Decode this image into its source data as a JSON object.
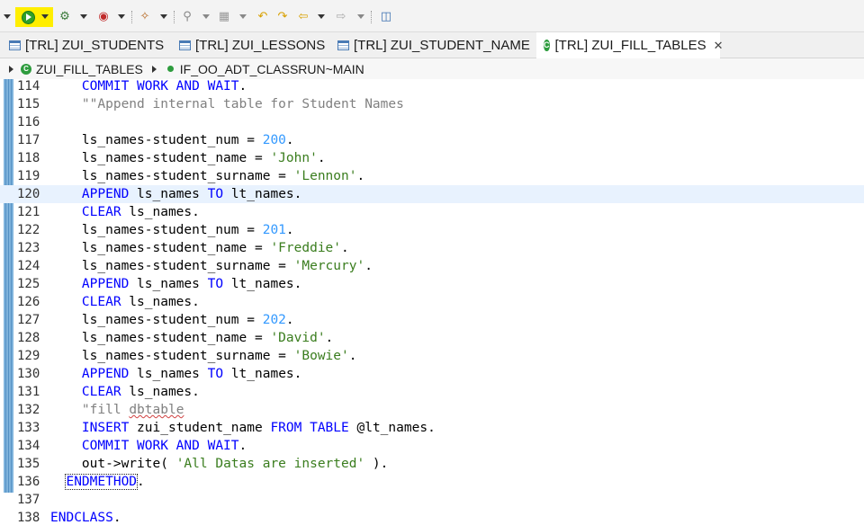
{
  "toolbar": {
    "items": [
      "run-icon",
      "debug-as-icon",
      "external-tools-icon",
      "new-wizard-icon",
      "search-icon",
      "annotation-icon",
      "prev-annotation-icon",
      "next-annotation-icon",
      "back-icon",
      "forward-icon",
      "open-console-icon"
    ]
  },
  "tabs": [
    {
      "label": "[TRL] ZUI_STUDENTS",
      "active": false
    },
    {
      "label": "[TRL] ZUI_LESSONS",
      "active": false
    },
    {
      "label": "[TRL] ZUI_STUDENT_NAME",
      "active": false
    },
    {
      "label": "[TRL] ZUI_FILL_TABLES",
      "active": true
    }
  ],
  "breadcrumb": {
    "class_name": "ZUI_FILL_TABLES",
    "method": "IF_OO_ADT_CLASSRUN~MAIN"
  },
  "editor": {
    "current_line": 120,
    "lines": [
      {
        "n": "114",
        "indent": "    ",
        "tokens": [
          [
            "kw",
            "COMMIT WORK AND WAIT"
          ],
          [
            "plain",
            "."
          ]
        ]
      },
      {
        "n": "115",
        "indent": "    ",
        "tokens": [
          [
            "com",
            "\"\"Append internal table for Student Names"
          ]
        ]
      },
      {
        "n": "116",
        "indent": "",
        "tokens": []
      },
      {
        "n": "117",
        "indent": "    ",
        "tokens": [
          [
            "plain",
            "ls_names-student_num = "
          ],
          [
            "num",
            "200"
          ],
          [
            "plain",
            "."
          ]
        ]
      },
      {
        "n": "118",
        "indent": "    ",
        "tokens": [
          [
            "plain",
            "ls_names-student_name = "
          ],
          [
            "str",
            "'John'"
          ],
          [
            "plain",
            "."
          ]
        ]
      },
      {
        "n": "119",
        "indent": "    ",
        "tokens": [
          [
            "plain",
            "ls_names-student_surname = "
          ],
          [
            "str",
            "'Lennon'"
          ],
          [
            "plain",
            "."
          ]
        ]
      },
      {
        "n": "120",
        "indent": "    ",
        "tokens": [
          [
            "kw",
            "APPEND"
          ],
          [
            "plain",
            " ls_names "
          ],
          [
            "kw",
            "TO"
          ],
          [
            "plain",
            " lt_names."
          ]
        ]
      },
      {
        "n": "121",
        "indent": "    ",
        "tokens": [
          [
            "kw",
            "CLEAR"
          ],
          [
            "plain",
            " ls_names."
          ]
        ]
      },
      {
        "n": "122",
        "indent": "    ",
        "tokens": [
          [
            "plain",
            "ls_names-student_num = "
          ],
          [
            "num",
            "201"
          ],
          [
            "plain",
            "."
          ]
        ]
      },
      {
        "n": "123",
        "indent": "    ",
        "tokens": [
          [
            "plain",
            "ls_names-student_name = "
          ],
          [
            "str",
            "'Freddie'"
          ],
          [
            "plain",
            "."
          ]
        ]
      },
      {
        "n": "124",
        "indent": "    ",
        "tokens": [
          [
            "plain",
            "ls_names-student_surname = "
          ],
          [
            "str",
            "'Mercury'"
          ],
          [
            "plain",
            "."
          ]
        ]
      },
      {
        "n": "125",
        "indent": "    ",
        "tokens": [
          [
            "kw",
            "APPEND"
          ],
          [
            "plain",
            " ls_names "
          ],
          [
            "kw",
            "TO"
          ],
          [
            "plain",
            " lt_names."
          ]
        ]
      },
      {
        "n": "126",
        "indent": "    ",
        "tokens": [
          [
            "kw",
            "CLEAR"
          ],
          [
            "plain",
            " ls_names."
          ]
        ]
      },
      {
        "n": "127",
        "indent": "    ",
        "tokens": [
          [
            "plain",
            "ls_names-student_num = "
          ],
          [
            "num",
            "202"
          ],
          [
            "plain",
            "."
          ]
        ]
      },
      {
        "n": "128",
        "indent": "    ",
        "tokens": [
          [
            "plain",
            "ls_names-student_name = "
          ],
          [
            "str",
            "'David'"
          ],
          [
            "plain",
            "."
          ]
        ]
      },
      {
        "n": "129",
        "indent": "    ",
        "tokens": [
          [
            "plain",
            "ls_names-student_surname = "
          ],
          [
            "str",
            "'Bowie'"
          ],
          [
            "plain",
            "."
          ]
        ]
      },
      {
        "n": "130",
        "indent": "    ",
        "tokens": [
          [
            "kw",
            "APPEND"
          ],
          [
            "plain",
            " ls_names "
          ],
          [
            "kw",
            "TO"
          ],
          [
            "plain",
            " lt_names."
          ]
        ]
      },
      {
        "n": "131",
        "indent": "    ",
        "tokens": [
          [
            "kw",
            "CLEAR"
          ],
          [
            "plain",
            " ls_names."
          ]
        ]
      },
      {
        "n": "132",
        "indent": "    ",
        "tokens": [
          [
            "com",
            "\"fill "
          ],
          [
            "com squig",
            "dbtable"
          ]
        ]
      },
      {
        "n": "133",
        "indent": "    ",
        "tokens": [
          [
            "kw",
            "INSERT"
          ],
          [
            "plain",
            " zui_student_name "
          ],
          [
            "kw",
            "FROM TABLE"
          ],
          [
            "plain",
            " @lt_names."
          ]
        ]
      },
      {
        "n": "134",
        "indent": "    ",
        "tokens": [
          [
            "kw",
            "COMMIT WORK AND WAIT"
          ],
          [
            "plain",
            "."
          ]
        ]
      },
      {
        "n": "135",
        "indent": "    ",
        "tokens": [
          [
            "plain",
            "out->write( "
          ],
          [
            "str",
            "'All Datas are inserted'"
          ],
          [
            "plain",
            " )."
          ]
        ]
      },
      {
        "n": "136",
        "indent": "  ",
        "tokens": [
          [
            "kw boxed",
            "ENDMETHOD"
          ],
          [
            "plain",
            "."
          ]
        ]
      },
      {
        "n": "137",
        "indent": "",
        "tokens": []
      },
      {
        "n": "138",
        "indent": "",
        "tokens": [
          [
            "kw",
            "ENDCLASS"
          ],
          [
            "plain",
            "."
          ]
        ]
      }
    ]
  }
}
